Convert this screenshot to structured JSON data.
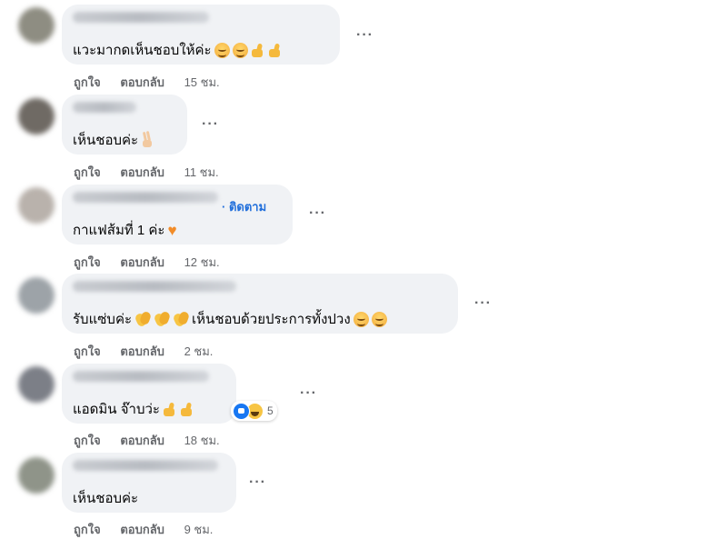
{
  "actions": {
    "like": "ถูกใจ",
    "reply": "ตอบกลับ"
  },
  "comments": [
    {
      "text": "แวะมากดเห็นชอบให้ค่ะ",
      "emojis": [
        "smile",
        "smile",
        "thumb",
        "thumb"
      ],
      "time": "15 ชม."
    },
    {
      "text": "เห็นชอบค่ะ",
      "emojis": [
        "victory"
      ],
      "time": "11 ชม."
    },
    {
      "text": "กาแฟส้มที่ 1 ค่ะ",
      "emojis": [
        "heart"
      ],
      "time": "12 ชม.",
      "follow": "· ติดตาม"
    },
    {
      "text": "รับแซ่บค่ะ",
      "text2": " เห็นชอบด้วยประการทั้งปวง",
      "time": "2 ชม."
    },
    {
      "text": "แอดมิน จ๊าบว่ะ",
      "emojis": [
        "thumb",
        "thumb"
      ],
      "time": "18 ชม.",
      "reaction_count": "5"
    },
    {
      "text": "เห็นชอบค่ะ",
      "time": "9 ชม."
    }
  ],
  "icons": {
    "more": "more-horizontal-icon"
  }
}
